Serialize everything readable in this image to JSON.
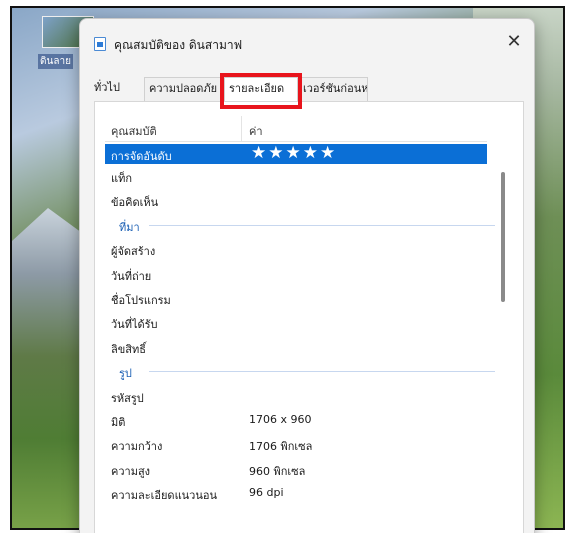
{
  "desktop": {
    "icon_label": "ดินลาย"
  },
  "dialog": {
    "title": "คุณสมบัติของ ดินสามาฟ",
    "close_glyph": "✕"
  },
  "tabs": [
    {
      "label": "ทั่วไป"
    },
    {
      "label": "ความปลอดภัย"
    },
    {
      "label": "รายละเอียด",
      "active": true
    },
    {
      "label": "เวอร์ชันก่อนหน้า"
    }
  ],
  "columns": {
    "property": "คุณสมบัติ",
    "value": "ค่า"
  },
  "rows": {
    "rating": {
      "key": "การจัดอันดับ",
      "value": "★★★★★"
    },
    "tags": {
      "key": "แท็ก"
    },
    "comments": {
      "key": "ข้อคิดเห็น"
    },
    "origin_group": "ที่มา",
    "authors": {
      "key": "ผู้จัดสร้าง"
    },
    "date_taken": {
      "key": "วันที่ถ่าย"
    },
    "program": {
      "key": "ชื่อโปรแกรม"
    },
    "date_acquired": {
      "key": "วันที่ได้รับ"
    },
    "copyright": {
      "key": "ลิขสิทธิ์"
    },
    "image_group": "รูป",
    "image_id": {
      "key": "รหัสรูป"
    },
    "dimensions": {
      "key": "มิติ",
      "value": "1706 x 960"
    },
    "width": {
      "key": "ความกว้าง",
      "value": "1706 พิกเซล"
    },
    "height": {
      "key": "ความสูง",
      "value": "960 พิกเซล"
    },
    "h_resolution": {
      "key": "ความละเอียดแนวนอน",
      "value": "96 dpi"
    }
  },
  "colors": {
    "selection": "#0b6fd6",
    "highlight_box": "#e8141c"
  }
}
